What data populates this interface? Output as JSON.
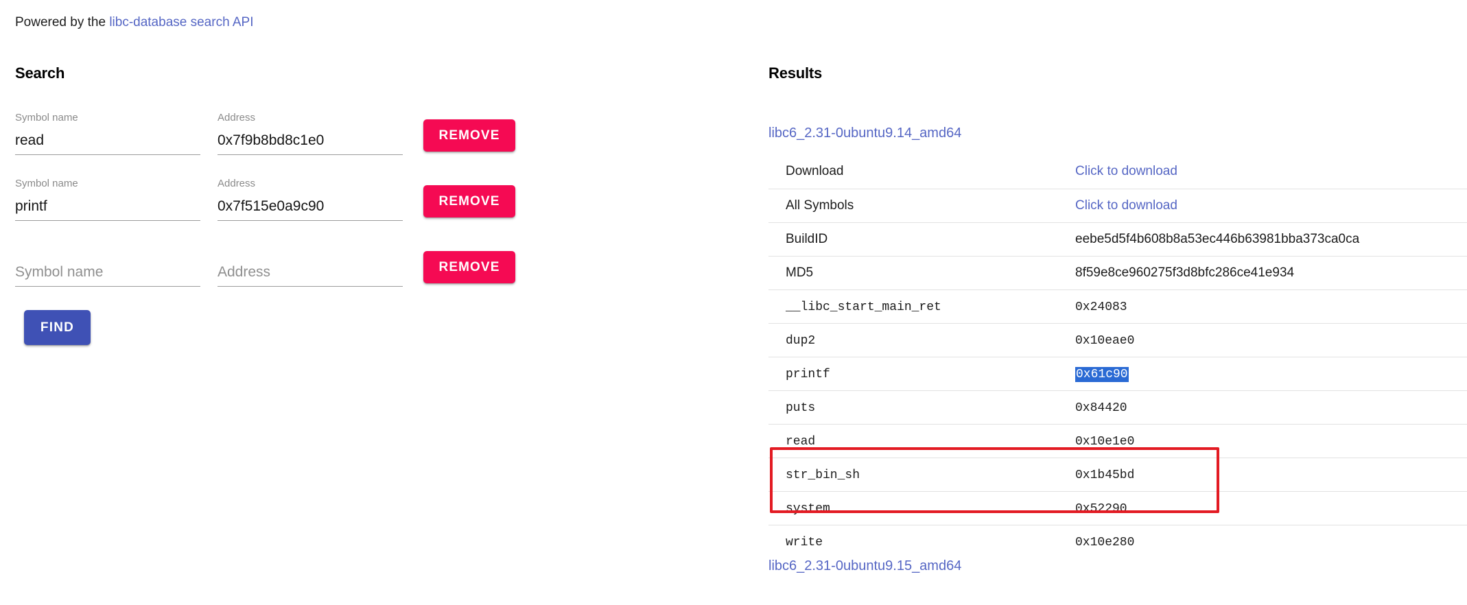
{
  "header": {
    "prefix_text": "Powered by the ",
    "api_link_label": "libc-database search API"
  },
  "search": {
    "heading": "Search",
    "labels": {
      "symbol": "Symbol name",
      "address": "Address"
    },
    "placeholders": {
      "symbol": "Symbol name",
      "address": "Address"
    },
    "rows": [
      {
        "symbol": "read",
        "address": "0x7f9b8bd8c1e0",
        "remove_label": "REMOVE"
      },
      {
        "symbol": "printf",
        "address": "0x7f515e0a9c90",
        "remove_label": "REMOVE"
      },
      {
        "symbol": "",
        "address": "",
        "remove_label": "REMOVE"
      }
    ],
    "find_label": "FIND"
  },
  "results": {
    "heading": "Results",
    "libc_top": "libc6_2.31-0ubuntu9.14_amd64",
    "libc_bottom": "libc6_2.31-0ubuntu9.15_amd64",
    "rows": [
      {
        "key": "Download",
        "key_style": "sans",
        "value": "Click to download",
        "value_style": "link",
        "highlighted": false
      },
      {
        "key": "All Symbols",
        "key_style": "sans",
        "value": "Click to download",
        "value_style": "link",
        "highlighted": false
      },
      {
        "key": "BuildID",
        "key_style": "sans",
        "value": "eebe5d5f4b608b8a53ec446b63981bba373ca0ca",
        "value_style": "sans",
        "highlighted": false
      },
      {
        "key": "MD5",
        "key_style": "sans",
        "value": "8f59e8ce960275f3d8bfc286ce41e934",
        "value_style": "sans",
        "highlighted": false
      },
      {
        "key": "__libc_start_main_ret",
        "key_style": "mono",
        "value": "0x24083",
        "value_style": "mono",
        "highlighted": false
      },
      {
        "key": "dup2",
        "key_style": "mono",
        "value": "0x10eae0",
        "value_style": "mono",
        "highlighted": false
      },
      {
        "key": "printf",
        "key_style": "mono",
        "value": "0x61c90",
        "value_style": "mono",
        "highlighted": true
      },
      {
        "key": "puts",
        "key_style": "mono",
        "value": "0x84420",
        "value_style": "mono",
        "highlighted": false
      },
      {
        "key": "read",
        "key_style": "mono",
        "value": "0x10e1e0",
        "value_style": "mono",
        "highlighted": false
      },
      {
        "key": "str_bin_sh",
        "key_style": "mono",
        "value": "0x1b45bd",
        "value_style": "mono",
        "highlighted": false
      },
      {
        "key": "system",
        "key_style": "mono",
        "value": "0x52290",
        "value_style": "mono",
        "highlighted": false
      },
      {
        "key": "write",
        "key_style": "mono",
        "value": "0x10e280",
        "value_style": "mono",
        "highlighted": false
      }
    ]
  },
  "colors": {
    "link": "#5566c4",
    "remove_button": "#f50a53",
    "find_button": "#3f51b5",
    "selection_highlight": "#2a6ad4",
    "annotation_box": "#e31b23"
  }
}
